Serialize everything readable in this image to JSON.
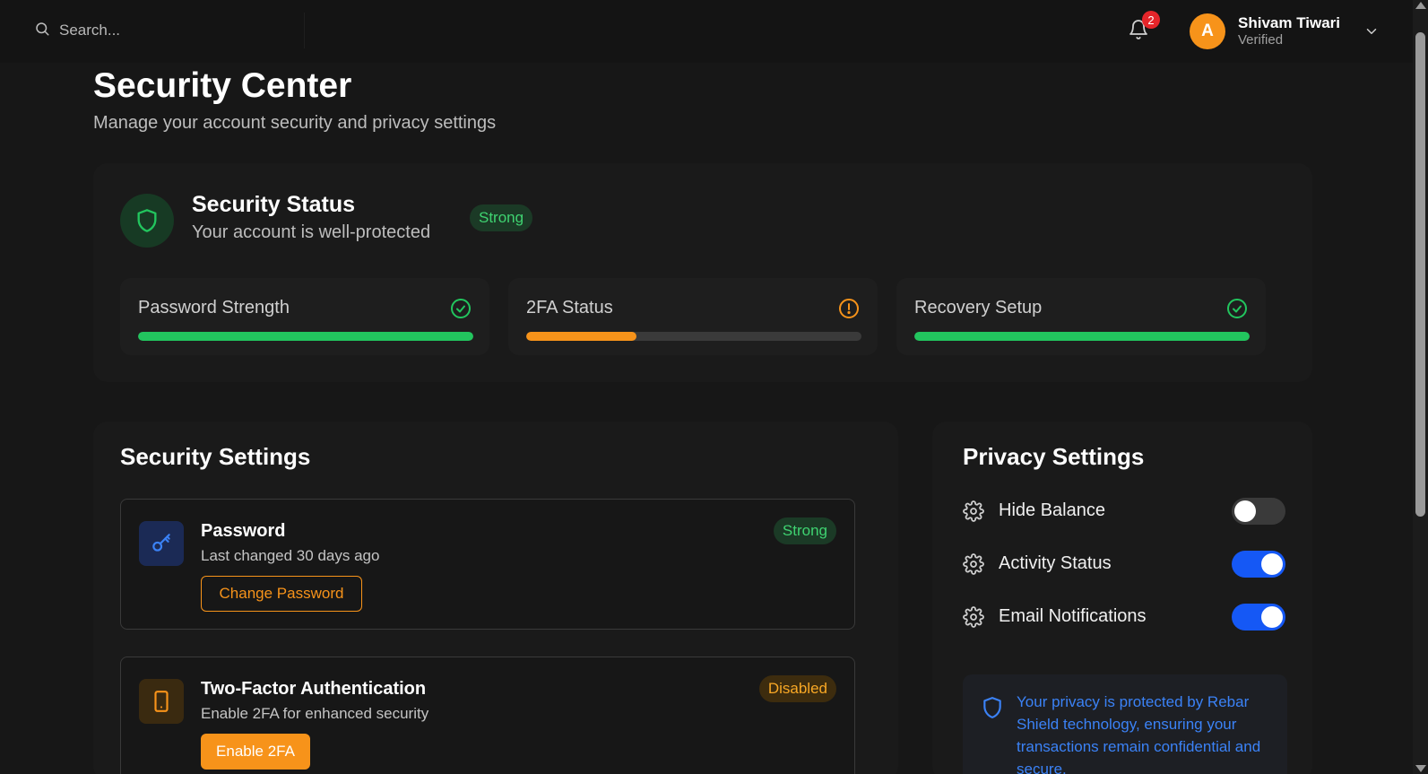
{
  "topbar": {
    "search_placeholder": "Search...",
    "notifications_count": "2",
    "user": {
      "avatar_initial": "A",
      "name": "Shivam Tiwari",
      "status": "Verified"
    }
  },
  "page": {
    "title": "Security Center",
    "subtitle": "Manage your account security and privacy settings"
  },
  "security_status": {
    "title": "Security Status",
    "subtitle": "Your account is well-protected",
    "badge": "Strong",
    "metrics": [
      {
        "label": "Password Strength",
        "icon": "check-circle-icon",
        "progress": 1.0,
        "color": "#22c55e"
      },
      {
        "label": "2FA Status",
        "icon": "alert-circle-icon",
        "progress": 0.33,
        "color": "#f7931a"
      },
      {
        "label": "Recovery Setup",
        "icon": "check-circle-icon",
        "progress": 1.0,
        "color": "#22c55e"
      }
    ]
  },
  "security_settings": {
    "title": "Security Settings",
    "items": [
      {
        "icon": "key-icon",
        "title": "Password",
        "description": "Last changed 30 days ago",
        "badge": "Strong",
        "action": "Change Password"
      },
      {
        "icon": "smartphone-icon",
        "title": "Two-Factor Authentication",
        "description": "Enable 2FA for enhanced security",
        "badge": "Disabled",
        "action": "Enable 2FA"
      }
    ]
  },
  "privacy_settings": {
    "title": "Privacy Settings",
    "items": [
      {
        "label": "Hide Balance",
        "enabled": false
      },
      {
        "label": "Activity Status",
        "enabled": true
      },
      {
        "label": "Email Notifications",
        "enabled": true
      }
    ],
    "notice": "Your privacy is protected by Rebar Shield technology, ensuring your transactions remain confidential and secure."
  },
  "colors": {
    "accent_orange": "#f7931a",
    "success_green": "#22c55e",
    "toggle_blue": "#1558f5",
    "info_blue": "#3b82f6"
  }
}
